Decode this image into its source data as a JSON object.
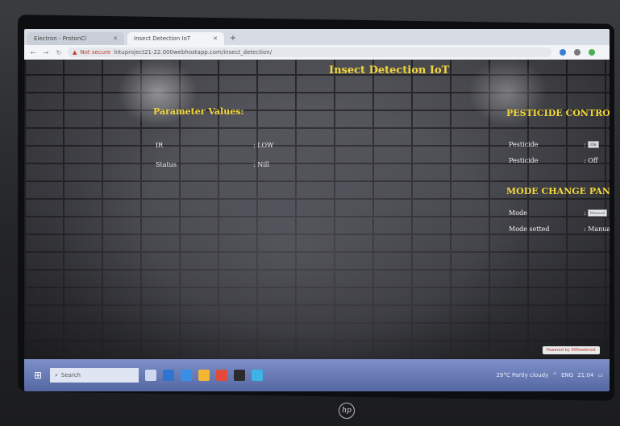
{
  "browser": {
    "tabs": [
      {
        "label": "Electron - ProtonCl"
      },
      {
        "label": "Insect Detection IoT"
      }
    ],
    "new_tab": "+",
    "address": {
      "security": "Not secure",
      "url": "lntuproject21-22.000webhostapp.com/insect_detection/"
    }
  },
  "page": {
    "title": "Insect Detection IoT",
    "parameters": {
      "heading": "Parameter Values:",
      "rows": [
        {
          "label": "IR",
          "value": ": LOW"
        },
        {
          "label": "Status",
          "value": ": Nill"
        }
      ]
    },
    "pesticide_panel": {
      "heading": "PESTICIDE CONTROL PA",
      "rows": [
        {
          "label": "Pesticide",
          "value": ":",
          "button": "On"
        },
        {
          "label": "Pesticide",
          "value": ": Off"
        }
      ]
    },
    "mode_panel": {
      "heading": "MODE CHANGE PANEL:",
      "rows": [
        {
          "label": "Mode",
          "value": ":",
          "input_value": "Manual"
        },
        {
          "label": "Mode setted",
          "value": ": Manual"
        }
      ]
    },
    "powered_by": "Powered by 000webhost"
  },
  "taskbar": {
    "search_placeholder": "Search",
    "weather": "29°C  Partly cloudy",
    "language": "ENG",
    "time": "21:04"
  },
  "laptop": {
    "brand": "hp"
  },
  "colors": {
    "heading": "#f3d63a",
    "text": "#f2f2f2",
    "taskbar": "#6577b3"
  }
}
